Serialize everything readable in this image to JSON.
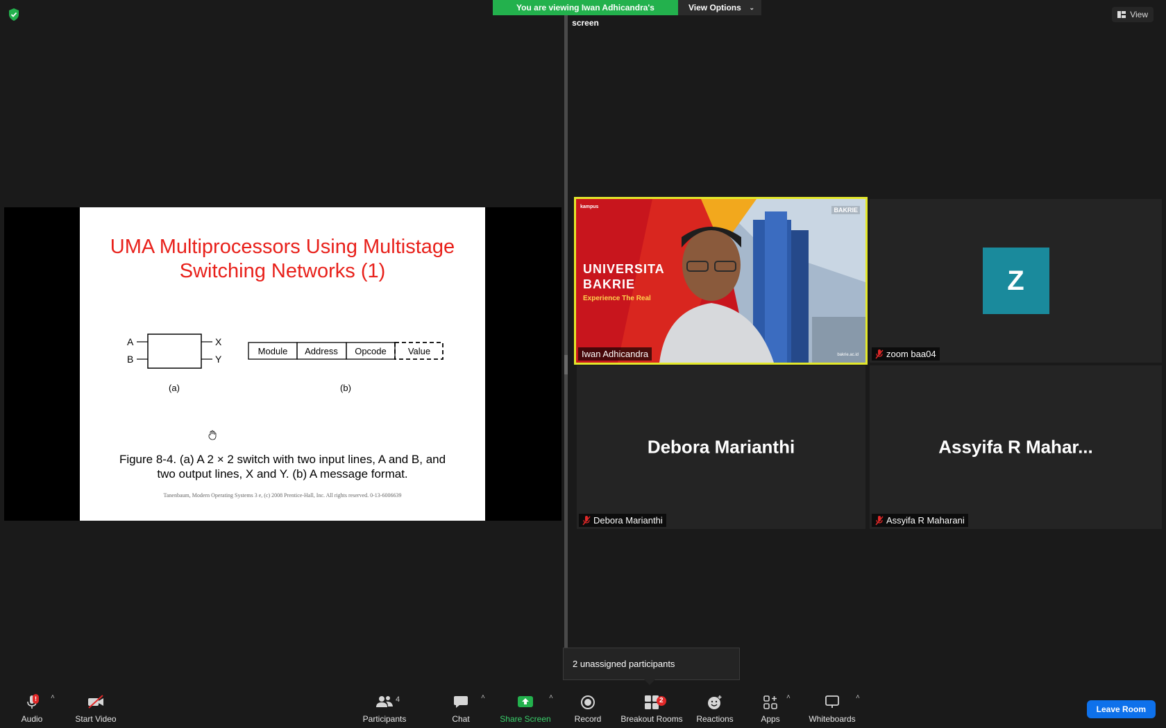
{
  "banner": {
    "viewing_text": "You are viewing Iwan Adhicandra's screen",
    "view_options": "View Options"
  },
  "view_button": "View",
  "slide": {
    "title_line1": "UMA Multiprocessors Using Multistage",
    "title_line2": "Switching Networks (1)",
    "switch_inputs": [
      "A",
      "B"
    ],
    "switch_outputs": [
      "X",
      "Y"
    ],
    "label_a": "(a)",
    "label_b": "(b)",
    "message_fields": [
      "Module",
      "Address",
      "Opcode",
      "Value"
    ],
    "caption_line1": "Figure 8-4. (a) A 2 × 2 switch with two input lines, A and B, and",
    "caption_line2": "two output lines, X and Y. (b) A message format.",
    "footer": "Tanenbaum, Modern Operating Systems 3 e, (c) 2008 Prentice-Hall, Inc. All rights reserved. 0-13-6006639"
  },
  "participants": {
    "iwan": {
      "name": "Iwan Adhicandra",
      "bg_line1": "UNIVERSITA",
      "bg_line2": "BAKRIE",
      "bg_tagline": "Experience The Real",
      "logo": "BAKRIE",
      "logo_left": "kampus",
      "url": "bakrie.ac.id"
    },
    "zoom": {
      "name": "zoom baa04",
      "initial": "Z"
    },
    "debora": {
      "big_name": "Debora Marianthi",
      "name": "Debora Marianthi"
    },
    "assyifa": {
      "big_name": "Assyifa R Mahar...",
      "name": "Assyifa R Maharani"
    }
  },
  "tooltip": "2 unassigned participants",
  "toolbar": {
    "audio": "Audio",
    "audio_alert": "!",
    "start_video": "Start Video",
    "participants": "Participants",
    "participants_count": "4",
    "chat": "Chat",
    "share_screen": "Share Screen",
    "record": "Record",
    "breakout_rooms": "Breakout Rooms",
    "breakout_count": "2",
    "reactions": "Reactions",
    "apps": "Apps",
    "whiteboards": "Whiteboards",
    "leave_room": "Leave Room"
  },
  "colors": {
    "share_green": "#23b14d",
    "active_speaker": "#e3e82b",
    "leave_blue": "#0e71eb",
    "slide_title_red": "#e8201a",
    "avatar_teal": "#1a8a9c"
  }
}
